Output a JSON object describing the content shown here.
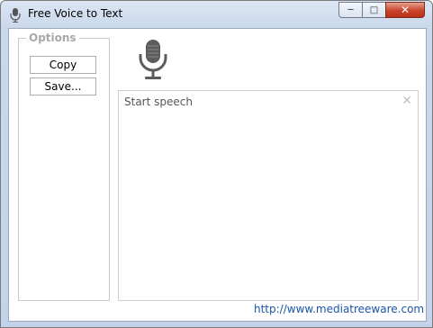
{
  "window": {
    "title": "Free Voice to Text",
    "controls": {
      "minimize": "─",
      "maximize": "□",
      "close": "✕"
    }
  },
  "options": {
    "legend": "Options",
    "copy_label": "Copy",
    "save_label": "Save..."
  },
  "speech": {
    "placeholder": "Start speech",
    "clear_icon": "✕"
  },
  "footer": {
    "link_text": "http://www.mediatreeware.com"
  },
  "colors": {
    "link": "#1a55a8",
    "close_button": "#c7442b",
    "legend_text": "#a8a8a8"
  }
}
